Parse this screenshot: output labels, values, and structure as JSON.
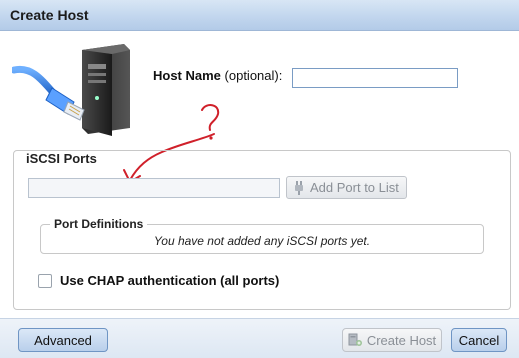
{
  "window": {
    "title": "Create Host"
  },
  "host_name": {
    "label_bold": "Host Name",
    "label_optional": " (optional):",
    "value": ""
  },
  "iscsi": {
    "legend": "iSCSI Ports",
    "port_value": "",
    "add_button_label": "Add Port to List"
  },
  "port_definitions": {
    "legend": "Port Definitions",
    "empty_message": "You have not added any iSCSI ports yet."
  },
  "chap": {
    "label": "Use CHAP authentication (all ports)",
    "checked": false
  },
  "footer": {
    "advanced_label": "Advanced",
    "create_label": "Create Host",
    "cancel_label": "Cancel"
  },
  "icons": {
    "server": "server-with-network-cable-icon",
    "plug": "plug-icon",
    "create_host": "add-host-icon"
  },
  "colors": {
    "titlebar": "#c2d6ee",
    "primary_button": "#b9cfeb",
    "annotation_red": "#d0202a"
  }
}
